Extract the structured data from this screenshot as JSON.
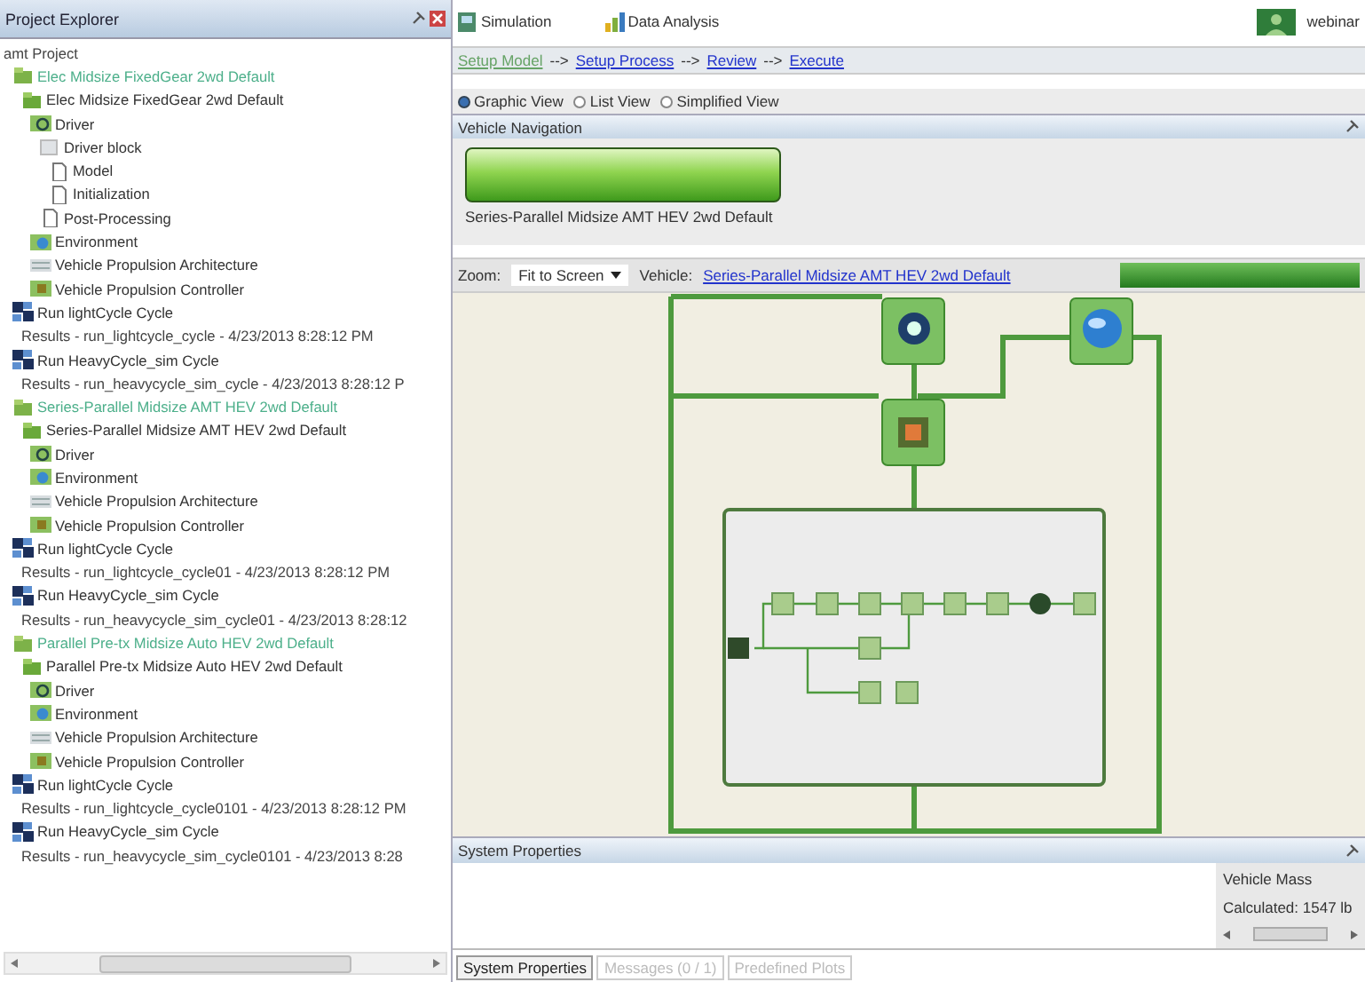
{
  "explorer": {
    "title": "Project Explorer",
    "tree": [
      {
        "label": "amt Project",
        "kind": "project",
        "children": [
          {
            "label": "Elec Midsize FixedGear 2wd Default",
            "kind": "config",
            "children": [
              {
                "label": "Elec Midsize FixedGear 2wd Default",
                "kind": "vehicle",
                "children": [
                  {
                    "label": "Driver",
                    "kind": "driver",
                    "children": [
                      {
                        "label": "Driver block",
                        "kind": "block",
                        "children": [
                          {
                            "label": "Model",
                            "kind": "file"
                          },
                          {
                            "label": "Initialization",
                            "kind": "file"
                          }
                        ]
                      },
                      {
                        "label": "Post-Processing",
                        "kind": "file"
                      }
                    ]
                  },
                  {
                    "label": "Environment",
                    "kind": "environment"
                  },
                  {
                    "label": "Vehicle Propulsion Architecture",
                    "kind": "architecture"
                  },
                  {
                    "label": "Vehicle Propulsion Controller",
                    "kind": "controller"
                  }
                ]
              }
            ]
          },
          {
            "label": "Run lightCycle Cycle",
            "kind": "run",
            "children": [
              {
                "label": "Results - run_lightcycle_cycle - 4/23/2013 8:28:12 PM",
                "kind": "results"
              }
            ]
          },
          {
            "label": "Run HeavyCycle_sim Cycle",
            "kind": "run",
            "children": [
              {
                "label": "Results - run_heavycycle_sim_cycle - 4/23/2013 8:28:12 P",
                "kind": "results"
              }
            ]
          },
          {
            "label": "Series-Parallel Midsize AMT HEV 2wd Default",
            "kind": "config",
            "children": [
              {
                "label": "Series-Parallel Midsize AMT HEV 2wd Default",
                "kind": "vehicle",
                "children": [
                  {
                    "label": "Driver",
                    "kind": "driver"
                  },
                  {
                    "label": "Environment",
                    "kind": "environment"
                  },
                  {
                    "label": "Vehicle Propulsion Architecture",
                    "kind": "architecture"
                  },
                  {
                    "label": "Vehicle Propulsion Controller",
                    "kind": "controller"
                  }
                ]
              }
            ]
          },
          {
            "label": "Run lightCycle Cycle",
            "kind": "run",
            "children": [
              {
                "label": "Results - run_lightcycle_cycle01 - 4/23/2013 8:28:12 PM",
                "kind": "results"
              }
            ]
          },
          {
            "label": "Run HeavyCycle_sim Cycle",
            "kind": "run",
            "children": [
              {
                "label": "Results - run_heavycycle_sim_cycle01 - 4/23/2013 8:28:12",
                "kind": "results"
              }
            ]
          },
          {
            "label": "Parallel Pre-tx Midsize Auto HEV 2wd Default",
            "kind": "config",
            "children": [
              {
                "label": "Parallel Pre-tx Midsize Auto HEV 2wd Default",
                "kind": "vehicle",
                "children": [
                  {
                    "label": "Driver",
                    "kind": "driver"
                  },
                  {
                    "label": "Environment",
                    "kind": "environment"
                  },
                  {
                    "label": "Vehicle Propulsion Architecture",
                    "kind": "architecture"
                  },
                  {
                    "label": "Vehicle Propulsion Controller",
                    "kind": "controller"
                  }
                ]
              }
            ]
          },
          {
            "label": "Run lightCycle Cycle",
            "kind": "run",
            "children": [
              {
                "label": "Results - run_lightcycle_cycle0101 - 4/23/2013 8:28:12 PM",
                "kind": "results"
              }
            ]
          },
          {
            "label": "Run HeavyCycle_sim Cycle",
            "kind": "run",
            "children": [
              {
                "label": "Results - run_heavycycle_sim_cycle0101 - 4/23/2013 8:28",
                "kind": "results"
              }
            ]
          }
        ]
      }
    ]
  },
  "toolbar": {
    "tabs": [
      {
        "label": "Simulation",
        "kind": "simulation"
      },
      {
        "label": "Data Analysis",
        "kind": "analysis"
      }
    ],
    "user": "webinar"
  },
  "steps": [
    {
      "label": "Setup Model",
      "selected": true
    },
    {
      "label": "Setup Process",
      "selected": false
    },
    {
      "label": "Review",
      "selected": false
    },
    {
      "label": "Execute",
      "selected": false
    }
  ],
  "step_separator": "-->",
  "views": [
    {
      "label": "Graphic View",
      "selected": true
    },
    {
      "label": "List View",
      "selected": false
    },
    {
      "label": "Simplified View",
      "selected": false
    }
  ],
  "vehicle_navigation": {
    "title": "Vehicle Navigation",
    "caption": "Series-Parallel Midsize AMT HEV 2wd Default"
  },
  "zoom_bar": {
    "zoom_label": "Zoom:",
    "zoom_value": "Fit to Screen",
    "vehicle_label": "Vehicle:",
    "vehicle_link": "Series-Parallel Midsize AMT HEV 2wd Default"
  },
  "system_properties": {
    "title": "System Properties",
    "side_title": "Vehicle Mass",
    "side_value": "Calculated: 1547 lb"
  },
  "bottom_tabs": [
    {
      "label": "System Properties",
      "selected": true
    },
    {
      "label": "Messages (0 / 1)",
      "selected": false
    },
    {
      "label": "Predefined Plots",
      "selected": false
    }
  ]
}
